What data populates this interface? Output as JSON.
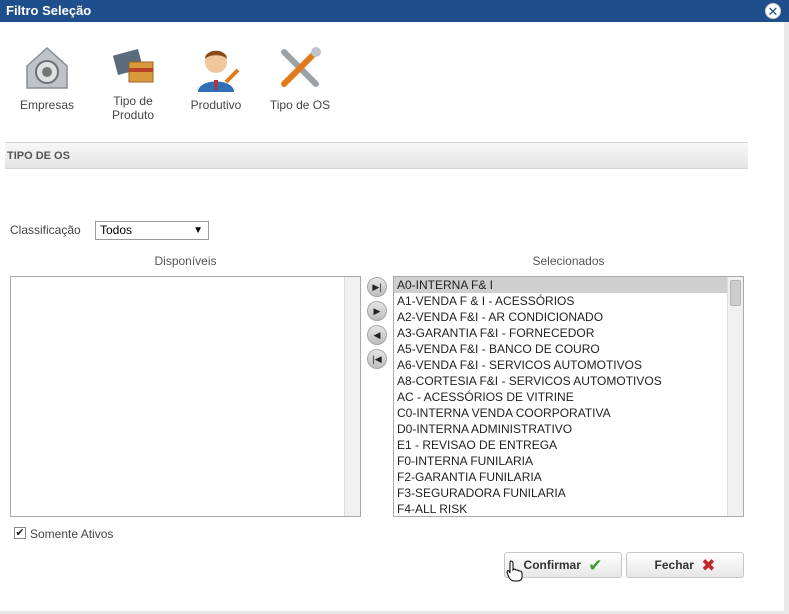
{
  "window": {
    "title": "Filtro Seleção",
    "close_symbol": "✕"
  },
  "toolbar": {
    "items": [
      {
        "label": "Empresas",
        "icon": "safe-icon"
      },
      {
        "label": "Tipo de Produto",
        "icon": "package-icon"
      },
      {
        "label": "Produtivo",
        "icon": "mechanic-icon"
      },
      {
        "label": "Tipo de OS",
        "icon": "tools-icon"
      }
    ]
  },
  "section": {
    "title": "TIPO DE OS"
  },
  "filter": {
    "classificacao_label": "Classificação",
    "classificacao_value": "Todos",
    "arrow": "▼"
  },
  "available": {
    "title": "Disponíveis",
    "items": []
  },
  "selected": {
    "title": "Selecionados",
    "items": [
      "A0-INTERNA F& I",
      "A1-VENDA F & I - ACESSÓRIOS",
      "A2-VENDA F&I - AR CONDICIONADO",
      "A3-GARANTIA F&I - FORNECEDOR",
      "A5-VENDA F&I - BANCO DE COURO",
      "A6-VENDA F&I - SERVICOS AUTOMOTIVOS",
      "A8-CORTESIA F&I - SERVICOS AUTOMOTIVOS",
      "AC - ACESSÓRIOS DE VITRINE",
      "C0-INTERNA VENDA COORPORATIVA",
      "D0-INTERNA ADMINISTRATIVO",
      "E1 - REVISAO DE ENTREGA",
      "F0-INTERNA FUNILARIA",
      "F2-GARANTIA FUNILARIA",
      "F3-SEGURADORA FUNILARIA",
      "F4-ALL RISK"
    ]
  },
  "move_buttons": {
    "move_all_right": "▶|",
    "move_right": "▶",
    "move_left": "◀",
    "move_all_left": "|◀"
  },
  "options": {
    "somente_ativos_label": "Somente Ativos",
    "somente_ativos_checked": true,
    "check_symbol": "✔"
  },
  "actions": {
    "confirm_label": "Confirmar",
    "confirm_symbol": "✔",
    "close_label": "Fechar",
    "close_symbol": "✖"
  },
  "colors": {
    "titlebar": "#1f4e8c",
    "confirm_icon": "#3a9a2a",
    "close_icon": "#c0262c"
  }
}
